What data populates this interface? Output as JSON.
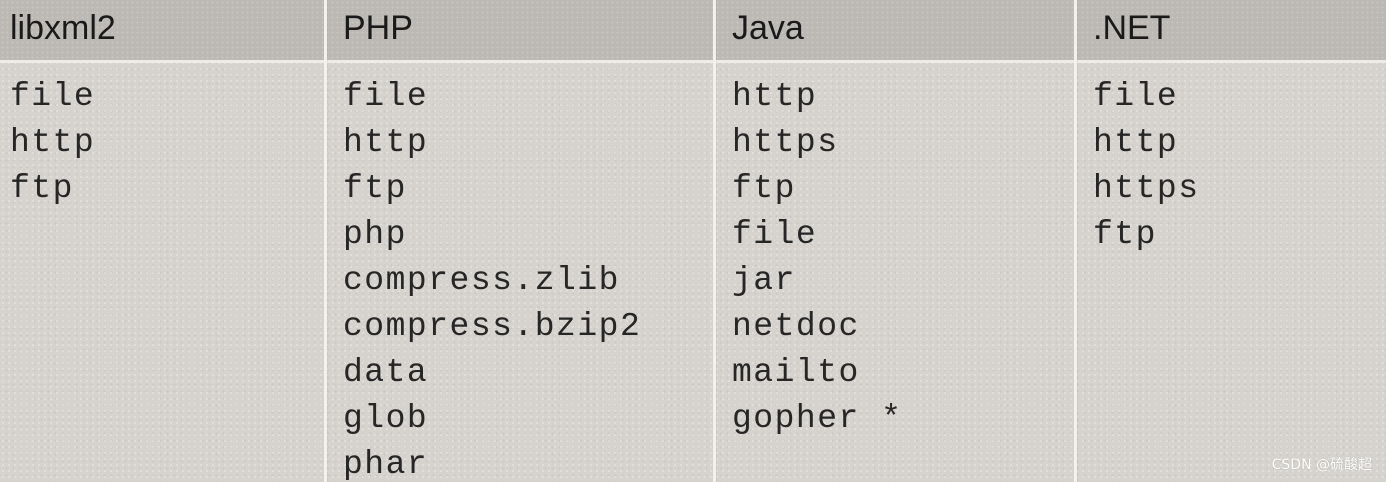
{
  "table": {
    "columns": [
      {
        "header": "libxml2",
        "items": [
          "file",
          "http",
          "ftp"
        ]
      },
      {
        "header": "PHP",
        "items": [
          "file",
          "http",
          "ftp",
          "php",
          "compress.zlib",
          "compress.bzip2",
          "data",
          "glob",
          "phar"
        ]
      },
      {
        "header": "Java",
        "items": [
          "http",
          "https",
          "ftp",
          "file",
          "jar",
          "netdoc",
          "mailto",
          "gopher *"
        ]
      },
      {
        "header": ".NET",
        "items": [
          "file",
          "http",
          "https",
          "ftp"
        ]
      }
    ]
  },
  "watermark": {
    "text": "CSDN @硫酸超"
  },
  "colors": {
    "cell_background": "#d6d3ce",
    "header_background": "#bcb9b4",
    "divider": "#f3f1ee",
    "text": "#262626"
  }
}
